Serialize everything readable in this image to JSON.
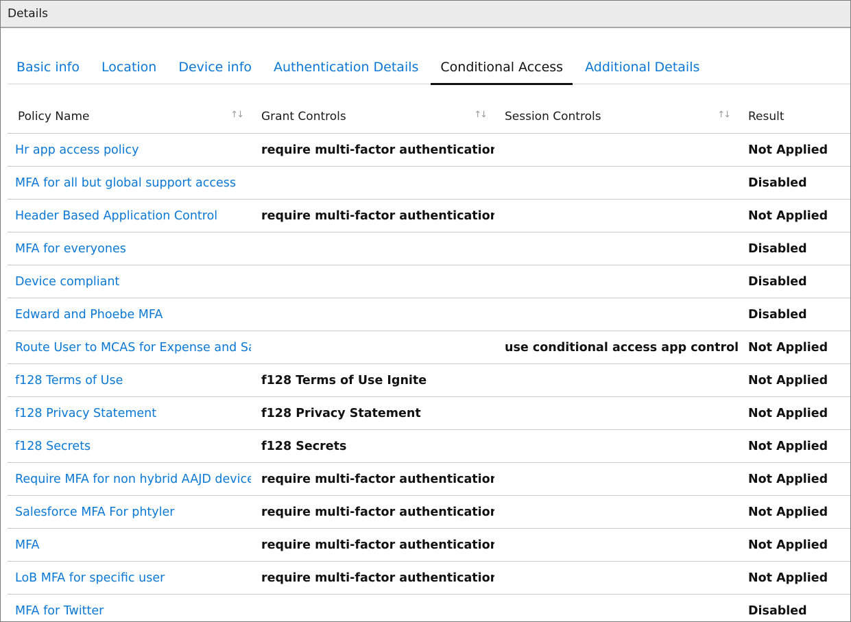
{
  "window": {
    "title": "Details"
  },
  "tabs": [
    {
      "label": "Basic info",
      "active": false
    },
    {
      "label": "Location",
      "active": false
    },
    {
      "label": "Device info",
      "active": false
    },
    {
      "label": "Authentication Details",
      "active": false
    },
    {
      "label": "Conditional Access",
      "active": true
    },
    {
      "label": "Additional Details",
      "active": false
    }
  ],
  "table": {
    "columns": [
      "Policy Name",
      "Grant Controls",
      "Session Controls",
      "Result"
    ],
    "sort_icon": "sort-arrows-icon",
    "rows": [
      {
        "name": "Hr app access policy",
        "grant": "require multi-factor authentication",
        "session": "",
        "result": "Not Applied"
      },
      {
        "name": "MFA for all but global support access",
        "grant": "",
        "session": "",
        "result": "Disabled"
      },
      {
        "name": "Header Based Application Control",
        "grant": "require multi-factor authentication",
        "session": "",
        "result": "Not Applied"
      },
      {
        "name": "MFA for everyones",
        "grant": "",
        "session": "",
        "result": "Disabled"
      },
      {
        "name": "Device compliant",
        "grant": "",
        "session": "",
        "result": "Disabled"
      },
      {
        "name": "Edward and Phoebe MFA",
        "grant": "",
        "session": "",
        "result": "Disabled"
      },
      {
        "name": "Route User to MCAS for Expense and Sa",
        "grant": "",
        "session": "use conditional access app control",
        "result": "Not Applied"
      },
      {
        "name": "f128 Terms of Use",
        "grant": "f128 Terms of Use Ignite",
        "session": "",
        "result": "Not Applied"
      },
      {
        "name": "f128 Privacy Statement",
        "grant": "f128 Privacy Statement",
        "session": "",
        "result": "Not Applied"
      },
      {
        "name": "f128 Secrets",
        "grant": "f128 Secrets",
        "session": "",
        "result": "Not Applied"
      },
      {
        "name": "Require MFA for non hybrid AAJD device",
        "grant": "require multi-factor authentication",
        "session": "",
        "result": "Not Applied"
      },
      {
        "name": "Salesforce MFA For phtyler",
        "grant": "require multi-factor authentication",
        "session": "",
        "result": "Not Applied"
      },
      {
        "name": "MFA",
        "grant": "require multi-factor authentication",
        "session": "",
        "result": "Not Applied"
      },
      {
        "name": "LoB MFA for specific user",
        "grant": "require multi-factor authentication",
        "session": "",
        "result": "Not Applied"
      },
      {
        "name": "MFA for Twitter",
        "grant": "",
        "session": "",
        "result": "Disabled"
      }
    ]
  },
  "colors": {
    "link": "#0a78d4",
    "titlebar": "#ececec",
    "border": "#c8c8c8"
  }
}
